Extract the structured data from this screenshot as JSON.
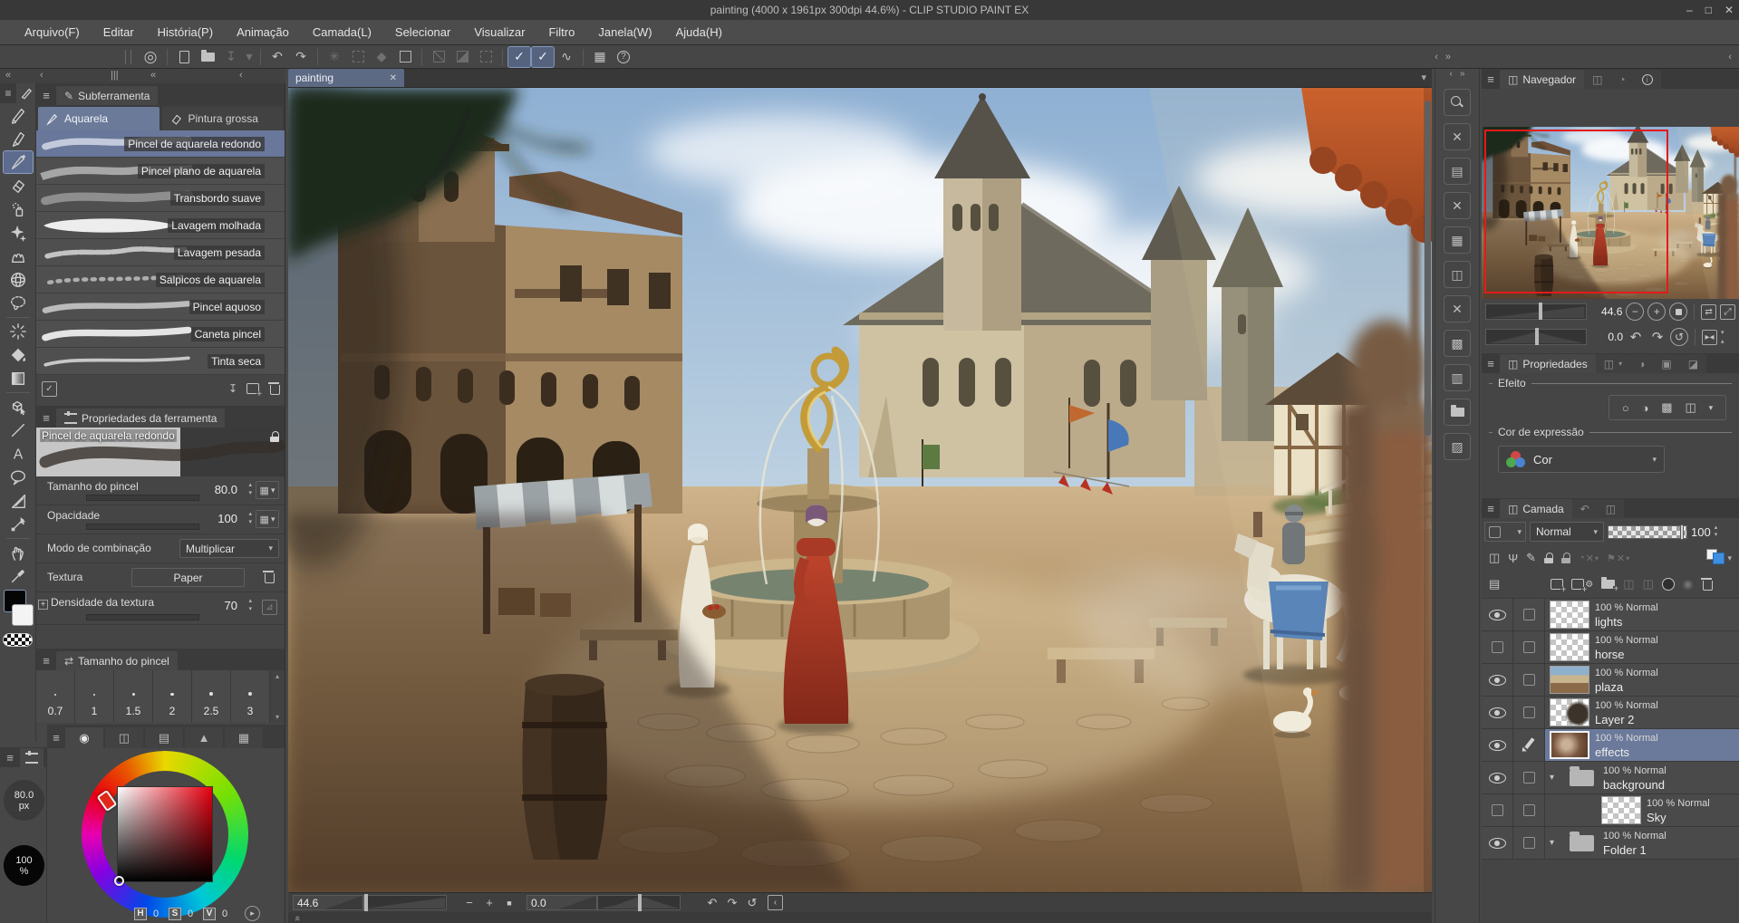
{
  "window": {
    "title": "painting (4000 x 1961px 300dpi 44.6%)  - CLIP STUDIO PAINT EX"
  },
  "menu": {
    "items": [
      "Arquivo(F)",
      "Editar",
      "História(P)",
      "Animação",
      "Camada(L)",
      "Selecionar",
      "Visualizar",
      "Filtro",
      "Janela(W)",
      "Ajuda(H)"
    ]
  },
  "canvas_tab": {
    "label": "painting"
  },
  "statusbar": {
    "zoom": "44.6",
    "rotation": "0.0"
  },
  "subtool": {
    "title": "Subferramenta",
    "tabs": [
      "Aquarela",
      "Pintura grossa"
    ],
    "brushes": [
      "Pincel de aquarela redondo",
      "Pincel plano de aquarela",
      "Transbordo suave",
      "Lavagem molhada",
      "Lavagem pesada",
      "Salpicos de aquarela",
      "Pincel aquoso",
      "Caneta pincel",
      "Tinta seca"
    ]
  },
  "tool_props": {
    "title": "Propriedades da ferramenta",
    "brush_name": "Pincel de aquarela redondo",
    "size_label": "Tamanho do pincel",
    "size_value": "80.0",
    "opacity_label": "Opacidade",
    "opacity_value": "100",
    "blend_label": "Modo de combinação",
    "blend_value": "Multiplicar",
    "texture_label": "Textura",
    "texture_value": "Paper",
    "density_label": "Densidade da textura",
    "density_value": "70"
  },
  "brush_size": {
    "title": "Tamanho do pincel",
    "presets": [
      "0.7",
      "1",
      "1.5",
      "2",
      "2.5",
      "3"
    ]
  },
  "quick": {
    "size_value": "80.0",
    "size_unit": "px",
    "opacity_value": "100",
    "opacity_unit": "%"
  },
  "color_panel": {
    "h": "H",
    "s": "S",
    "v": "V",
    "h_value": "0",
    "s_value": "0",
    "v_value": "0"
  },
  "navigator": {
    "title": "Navegador",
    "zoom": "44.6",
    "rotation": "0.0"
  },
  "layer_props": {
    "title": "Propriedades",
    "effect": "Efeito",
    "expression": "Cor de expressão",
    "expression_value": "Cor"
  },
  "layers": {
    "title": "Camada",
    "blend_mode": "Normal",
    "opacity": "100",
    "items": [
      {
        "info": "100 % Normal",
        "name": "lights"
      },
      {
        "info": "100 % Normal",
        "name": "horse"
      },
      {
        "info": "100 % Normal",
        "name": "plaza"
      },
      {
        "info": "100 % Normal",
        "name": "Layer 2"
      },
      {
        "info": "100 % Normal",
        "name": "effects"
      },
      {
        "info": "100 % Normal",
        "name": "background"
      },
      {
        "info": "100 % Normal",
        "name": "Sky"
      },
      {
        "info": "100 % Normal",
        "name": "Folder 1"
      }
    ]
  },
  "glyphs": {
    "hamburger": "≡",
    "close": "✕",
    "minimize": "–",
    "maximize": "□",
    "chev_down": "▾",
    "chev_up": "▴",
    "chev_left": "‹",
    "chev_right": "›",
    "collapse_left": "«",
    "collapse_right": "»",
    "undo": "↶",
    "redo": "↷",
    "rotate_ccw": "↺",
    "rotate_cw": "↻",
    "minus": "−",
    "plus": "+",
    "square_stop": "■",
    "check": "✓",
    "wave": "∿",
    "sparkle": "✳",
    "grid": "▦",
    "question": "?",
    "pen": "✎",
    "gear": "⚙",
    "flag": "⚑",
    "list": "▤",
    "tripod": "Ψ",
    "circle": "○",
    "halfcircle": "◑",
    "dots": "▩",
    "stack": "◫",
    "target": "◉",
    "quarter": "◔",
    "info": "i",
    "tri_right": "▸",
    "tri_left": "◂",
    "x": "✕",
    "swap": "⇄",
    "spin_up": "▴",
    "spin_down": "▾",
    "logo": "◎"
  },
  "colors": {
    "selection": "#6b7a99",
    "layer_color": "#3f8fe0",
    "nav_frame": "#e51a1a",
    "tab": "#5d6a84"
  }
}
